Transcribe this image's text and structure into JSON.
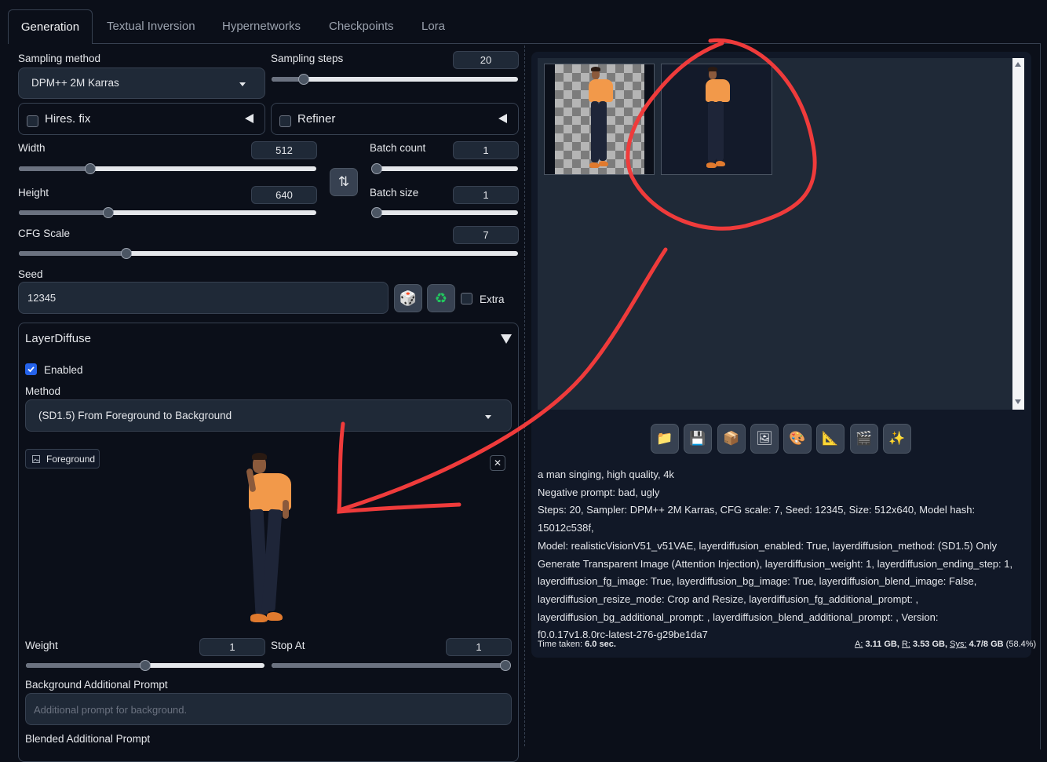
{
  "tabs": [
    "Generation",
    "Textual Inversion",
    "Hypernetworks",
    "Checkpoints",
    "Lora"
  ],
  "sampling": {
    "method_label": "Sampling method",
    "method_value": "DPM++ 2M Karras",
    "steps_label": "Sampling steps",
    "steps_value": "20",
    "steps_fraction": 0.13
  },
  "hires": {
    "label": "Hires. fix",
    "checked": false
  },
  "refiner": {
    "label": "Refiner",
    "checked": false
  },
  "width": {
    "label": "Width",
    "value": "512",
    "fraction": 0.24
  },
  "height": {
    "label": "Height",
    "value": "640",
    "fraction": 0.3
  },
  "batch_count": {
    "label": "Batch count",
    "value": "1",
    "fraction": 0.0
  },
  "batch_size": {
    "label": "Batch size",
    "value": "1",
    "fraction": 0.0
  },
  "cfg": {
    "label": "CFG Scale",
    "value": "7",
    "fraction": 0.215
  },
  "seed": {
    "label": "Seed",
    "value": "12345",
    "extra_label": "Extra"
  },
  "layerdiffuse": {
    "title": "LayerDiffuse",
    "enabled_label": "Enabled",
    "enabled": true,
    "method_label": "Method",
    "method_value": "(SD1.5) From Foreground to Background",
    "foreground_label": "Foreground",
    "close_symbol": "✕",
    "weight_label": "Weight",
    "weight_value": "1",
    "weight_fraction": 0.5,
    "stopat_label": "Stop At",
    "stopat_value": "1",
    "stopat_fraction": 1.0,
    "bg_prompt_label": "Background Additional Prompt",
    "bg_prompt_placeholder": "Additional prompt for background.",
    "blended_label": "Blended Additional Prompt"
  },
  "icons": {
    "swap": "⇅",
    "dice": "🎲",
    "recycle": "♻",
    "tools": [
      "📁",
      "💾",
      "📦",
      "🖼",
      "🎨",
      "📐",
      "🎬",
      "✨"
    ],
    "tool_names": [
      "open-folder-icon",
      "save-icon",
      "zip-icon",
      "send-to-img2img-icon",
      "send-to-inpaint-icon",
      "send-to-extras-icon",
      "video-icon",
      "sparkle-icon"
    ]
  },
  "output": {
    "prompt": "a man singing, high quality, 4k",
    "negative": "Negative prompt: bad, ugly",
    "params": [
      "Steps: 20, Sampler: DPM++ 2M Karras, CFG scale: 7, Seed: 12345, Size: 512x640, Model hash: 15012c538f,",
      "Model: realisticVisionV51_v51VAE, layerdiffusion_enabled: True, layerdiffusion_method: (SD1.5) Only",
      "Generate Transparent Image (Attention Injection), layerdiffusion_weight: 1, layerdiffusion_ending_step: 1,",
      "layerdiffusion_fg_image: True, layerdiffusion_bg_image: True, layerdiffusion_blend_image: False,",
      "layerdiffusion_resize_mode: Crop and Resize, layerdiffusion_fg_additional_prompt: ,",
      "layerdiffusion_bg_additional_prompt: , layerdiffusion_blend_additional_prompt: , Version:",
      "f0.0.17v1.8.0rc-latest-276-g29be1da7"
    ],
    "time_label": "Time taken:",
    "time_value": "6.0 sec.",
    "mem_a_label": "A:",
    "mem_a": "3.11 GB,",
    "mem_r_label": "R:",
    "mem_r": "3.53 GB,",
    "mem_sys_label": "Sys:",
    "mem_sys": "4.7/8 GB",
    "mem_pct": "(58.4%)"
  },
  "colors": {
    "background": "#0b0f19",
    "panel": "#1f2937",
    "accent": "#2563eb",
    "annotation": "#ef3b3b"
  }
}
